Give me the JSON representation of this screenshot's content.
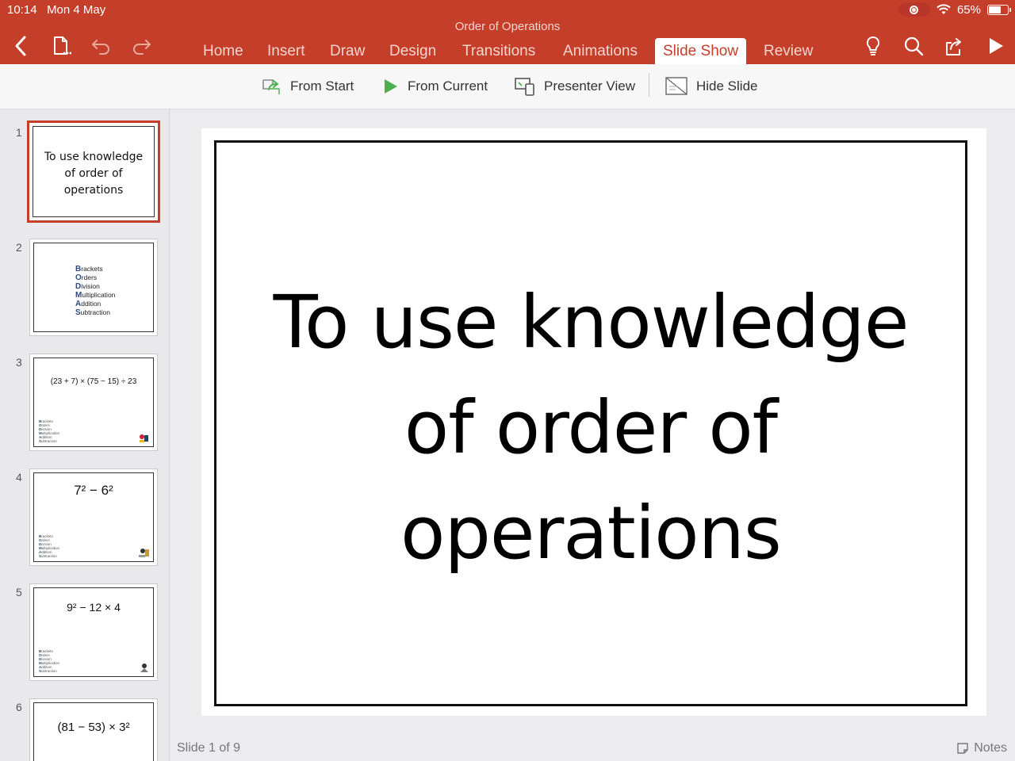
{
  "status_bar": {
    "time": "10:14",
    "date": "Mon 4 May",
    "battery": "65%",
    "battery_level": 0.65
  },
  "document": {
    "title": "Order of Operations"
  },
  "tabs": [
    {
      "label": "Home",
      "active": false
    },
    {
      "label": "Insert",
      "active": false
    },
    {
      "label": "Draw",
      "active": false
    },
    {
      "label": "Design",
      "active": false
    },
    {
      "label": "Transitions",
      "active": false
    },
    {
      "label": "Animations",
      "active": false
    },
    {
      "label": "Slide Show",
      "active": true
    },
    {
      "label": "Review",
      "active": false
    }
  ],
  "ribbon": {
    "from_start": "From Start",
    "from_current": "From Current",
    "presenter_view": "Presenter View",
    "hide_slide": "Hide Slide"
  },
  "thumbnails": [
    {
      "number": "1",
      "lines": [
        "To use knowledge",
        "of order of",
        "operations"
      ]
    },
    {
      "number": "2",
      "bodmas": [
        {
          "letter": "B",
          "rest": "rackets"
        },
        {
          "letter": "O",
          "rest": "rders"
        },
        {
          "letter": "D",
          "rest": "ivision"
        },
        {
          "letter": "M",
          "rest": "ultiplication"
        },
        {
          "letter": "A",
          "rest": "ddition"
        },
        {
          "letter": "S",
          "rest": "ubtraction"
        }
      ]
    },
    {
      "number": "3",
      "expression": "(23 + 7) × (75 − 15) ÷ 23"
    },
    {
      "number": "4",
      "expression_base": "7² − 6²"
    },
    {
      "number": "5",
      "expression_base": "9² − 12 × 4"
    },
    {
      "number": "6",
      "expression_base": "(81 − 53) × 3²"
    }
  ],
  "slide": {
    "title_lines": [
      "To use knowledge",
      "of order of",
      "operations"
    ]
  },
  "footer": {
    "slide_counter": "Slide 1 of 9",
    "notes_label": "Notes"
  },
  "colors": {
    "accent": "#c43e2a",
    "ribbon_green": "#4caf50"
  }
}
